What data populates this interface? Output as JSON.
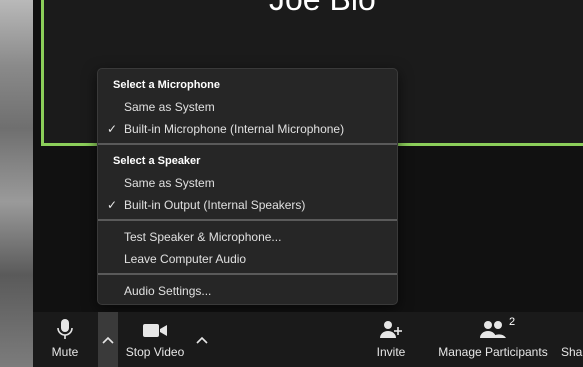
{
  "participant": {
    "name": "Joe Bio"
  },
  "menu": {
    "microphone_header": "Select a Microphone",
    "microphone_items": [
      {
        "label": "Same as System",
        "checked": false
      },
      {
        "label": "Built-in Microphone (Internal Microphone)",
        "checked": true
      }
    ],
    "speaker_header": "Select a Speaker",
    "speaker_items": [
      {
        "label": "Same as System",
        "checked": false
      },
      {
        "label": "Built-in Output (Internal Speakers)",
        "checked": true
      }
    ],
    "test_label": "Test Speaker & Microphone...",
    "leave_label": "Leave Computer Audio",
    "settings_label": "Audio Settings...",
    "check_glyph": "✓"
  },
  "toolbar": {
    "mute_label": "Mute",
    "stop_video_label": "Stop Video",
    "invite_label": "Invite",
    "participants_label": "Manage Participants",
    "participants_count": "2",
    "share_label": "Sha"
  },
  "icons": {
    "mic": "microphone-icon",
    "video": "video-camera-icon",
    "invite": "add-person-icon",
    "participants": "people-icon",
    "caret": "chevron-up-icon"
  },
  "colors": {
    "active_speaker_border": "#8ccf5a",
    "menu_background": "#262626",
    "toolbar_background": "#1a1a1a"
  }
}
